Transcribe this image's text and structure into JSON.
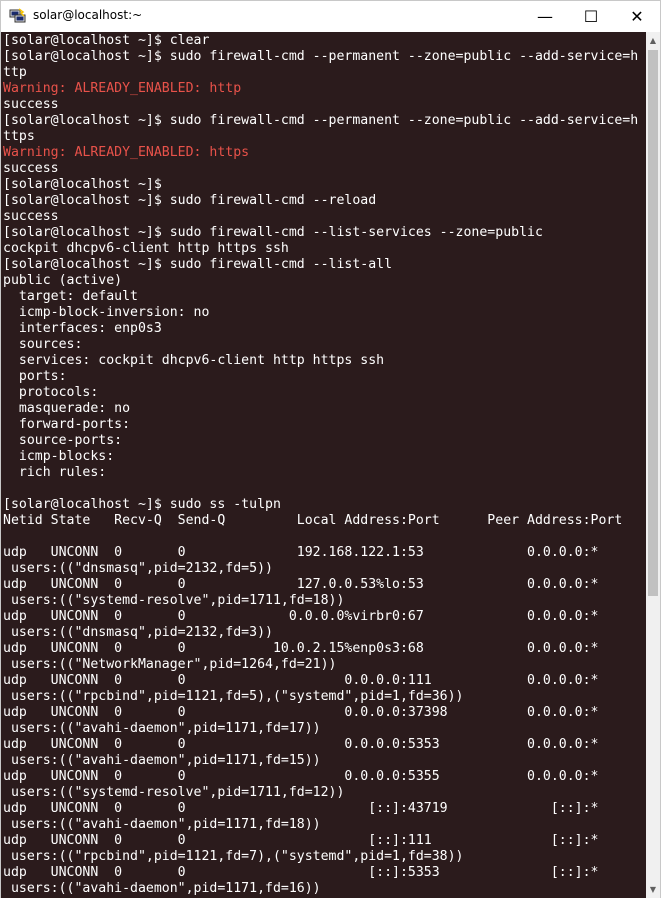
{
  "window": {
    "title": "solar@localhost:~",
    "icons": {
      "app": "putty-icon",
      "minimize": "minimize-icon",
      "maximize": "maximize-icon",
      "close": "close-icon"
    },
    "controls": {
      "minimize": "—",
      "maximize": "☐",
      "close": "✕"
    }
  },
  "colors": {
    "background": "#2b1b1c",
    "text": "#ffffff",
    "warning": "#e8524a"
  },
  "terminal": {
    "lines": [
      {
        "text": "[solar@localhost ~]$ clear",
        "style": "normal"
      },
      {
        "text": "[solar@localhost ~]$ sudo firewall-cmd --permanent --zone=public --add-service=h",
        "style": "normal"
      },
      {
        "text": "ttp",
        "style": "normal"
      },
      {
        "text": "Warning: ALREADY_ENABLED: http",
        "style": "warning"
      },
      {
        "text": "success",
        "style": "normal"
      },
      {
        "text": "[solar@localhost ~]$ sudo firewall-cmd --permanent --zone=public --add-service=h",
        "style": "normal"
      },
      {
        "text": "ttps",
        "style": "normal"
      },
      {
        "text": "Warning: ALREADY_ENABLED: https",
        "style": "warning"
      },
      {
        "text": "success",
        "style": "normal"
      },
      {
        "text": "[solar@localhost ~]$",
        "style": "normal"
      },
      {
        "text": "[solar@localhost ~]$ sudo firewall-cmd --reload",
        "style": "normal"
      },
      {
        "text": "success",
        "style": "normal"
      },
      {
        "text": "[solar@localhost ~]$ sudo firewall-cmd --list-services --zone=public",
        "style": "normal"
      },
      {
        "text": "cockpit dhcpv6-client http https ssh",
        "style": "normal"
      },
      {
        "text": "[solar@localhost ~]$ sudo firewall-cmd --list-all",
        "style": "normal"
      },
      {
        "text": "public (active)",
        "style": "normal"
      },
      {
        "text": "  target: default",
        "style": "normal"
      },
      {
        "text": "  icmp-block-inversion: no",
        "style": "normal"
      },
      {
        "text": "  interfaces: enp0s3",
        "style": "normal"
      },
      {
        "text": "  sources:",
        "style": "normal"
      },
      {
        "text": "  services: cockpit dhcpv6-client http https ssh",
        "style": "normal"
      },
      {
        "text": "  ports:",
        "style": "normal"
      },
      {
        "text": "  protocols:",
        "style": "normal"
      },
      {
        "text": "  masquerade: no",
        "style": "normal"
      },
      {
        "text": "  forward-ports:",
        "style": "normal"
      },
      {
        "text": "  source-ports:",
        "style": "normal"
      },
      {
        "text": "  icmp-blocks:",
        "style": "normal"
      },
      {
        "text": "  rich rules:",
        "style": "normal"
      },
      {
        "text": "",
        "style": "normal"
      },
      {
        "text": "[solar@localhost ~]$ sudo ss -tulpn",
        "style": "normal"
      },
      {
        "text": "Netid State   Recv-Q  Send-Q         Local Address:Port      Peer Address:Port",
        "style": "normal"
      },
      {
        "text": "",
        "style": "normal"
      },
      {
        "text": "udp   UNCONN  0       0              192.168.122.1:53             0.0.0.0:*",
        "style": "normal"
      },
      {
        "text": " users:((\"dnsmasq\",pid=2132,fd=5))",
        "style": "normal"
      },
      {
        "text": "udp   UNCONN  0       0              127.0.0.53%lo:53             0.0.0.0:*",
        "style": "normal"
      },
      {
        "text": " users:((\"systemd-resolve\",pid=1711,fd=18))",
        "style": "normal"
      },
      {
        "text": "udp   UNCONN  0       0             0.0.0.0%virbr0:67             0.0.0.0:*",
        "style": "normal"
      },
      {
        "text": " users:((\"dnsmasq\",pid=2132,fd=3))",
        "style": "normal"
      },
      {
        "text": "udp   UNCONN  0       0           10.0.2.15%enp0s3:68             0.0.0.0:*",
        "style": "normal"
      },
      {
        "text": " users:((\"NetworkManager\",pid=1264,fd=21))",
        "style": "normal"
      },
      {
        "text": "udp   UNCONN  0       0                    0.0.0.0:111            0.0.0.0:*",
        "style": "normal"
      },
      {
        "text": " users:((\"rpcbind\",pid=1121,fd=5),(\"systemd\",pid=1,fd=36))",
        "style": "normal"
      },
      {
        "text": "udp   UNCONN  0       0                    0.0.0.0:37398          0.0.0.0:*",
        "style": "normal"
      },
      {
        "text": " users:((\"avahi-daemon\",pid=1171,fd=17))",
        "style": "normal"
      },
      {
        "text": "udp   UNCONN  0       0                    0.0.0.0:5353           0.0.0.0:*",
        "style": "normal"
      },
      {
        "text": " users:((\"avahi-daemon\",pid=1171,fd=15))",
        "style": "normal"
      },
      {
        "text": "udp   UNCONN  0       0                    0.0.0.0:5355           0.0.0.0:*",
        "style": "normal"
      },
      {
        "text": " users:((\"systemd-resolve\",pid=1711,fd=12))",
        "style": "normal"
      },
      {
        "text": "udp   UNCONN  0       0                       [::]:43719             [::]:*",
        "style": "normal"
      },
      {
        "text": " users:((\"avahi-daemon\",pid=1171,fd=18))",
        "style": "normal"
      },
      {
        "text": "udp   UNCONN  0       0                       [::]:111               [::]:*",
        "style": "normal"
      },
      {
        "text": " users:((\"rpcbind\",pid=1121,fd=7),(\"systemd\",pid=1,fd=38))",
        "style": "normal"
      },
      {
        "text": "udp   UNCONN  0       0                       [::]:5353              [::]:*",
        "style": "normal"
      },
      {
        "text": " users:((\"avahi-daemon\",pid=1171,fd=16))",
        "style": "normal"
      }
    ]
  }
}
